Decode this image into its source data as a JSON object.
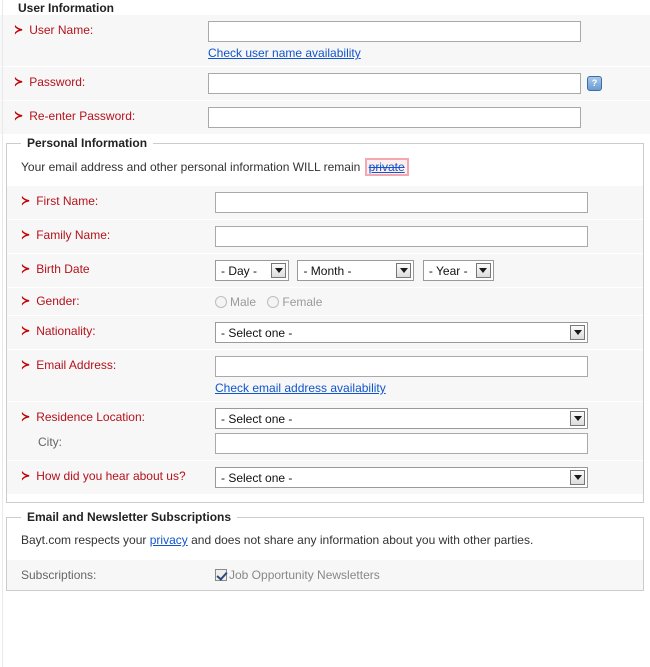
{
  "sections": {
    "user_information": {
      "title": "User Information",
      "fields": {
        "user_name": {
          "label": "User Name:",
          "bullet": "≻",
          "value": "",
          "check_link": "Check user name availability"
        },
        "password": {
          "label": "Password:",
          "bullet": "≻",
          "value": "",
          "help_icon": "question-mark-icon",
          "help_label": "?"
        },
        "reenter_password": {
          "label": "Re-enter Password:",
          "bullet": "≻",
          "value": ""
        }
      }
    },
    "personal_information": {
      "title": "Personal Information",
      "note_before": "Your email address and other personal information WILL remain",
      "note_link": "private",
      "note_after": "",
      "fields": {
        "first_name": {
          "label": "First Name:",
          "bullet": "≻",
          "value": ""
        },
        "family_name": {
          "label": "Family Name:",
          "bullet": "≻",
          "value": ""
        },
        "birth_date": {
          "label": "Birth Date",
          "bullet": "≻",
          "day": "- Day -",
          "month": "- Month -",
          "year": "- Year -"
        },
        "gender": {
          "label": "Gender:",
          "bullet": "≻",
          "male": "Male",
          "female": "Female"
        },
        "nationality": {
          "label": "Nationality:",
          "bullet": "≻",
          "selected": "- Select one -"
        },
        "email_address": {
          "label": "Email Address:",
          "bullet": "≻",
          "value": "",
          "check_link": "Check email address availability"
        },
        "residence_location": {
          "label": "Residence Location:",
          "bullet": "≻",
          "selected": "- Select one -"
        },
        "city": {
          "label": "City:",
          "value": ""
        },
        "hear_about_us": {
          "label": "How did you hear about us?",
          "bullet": "≻",
          "selected": "- Select one -"
        }
      }
    },
    "email_newsletter": {
      "title": "Email and Newsletter Subscriptions",
      "note_before": "Bayt.com respects your",
      "note_link": "privacy",
      "note_after": "and does not share any information about you with other parties.",
      "fields": {
        "subscriptions": {
          "label": "Subscriptions:",
          "option_job_newsletters": "Job Opportunity Newsletters"
        }
      }
    }
  },
  "colors": {
    "required_label": "#b5121b",
    "link": "#1155cc",
    "highlight_border": "#f6a6ae",
    "row_background": "#f7f7f7"
  }
}
